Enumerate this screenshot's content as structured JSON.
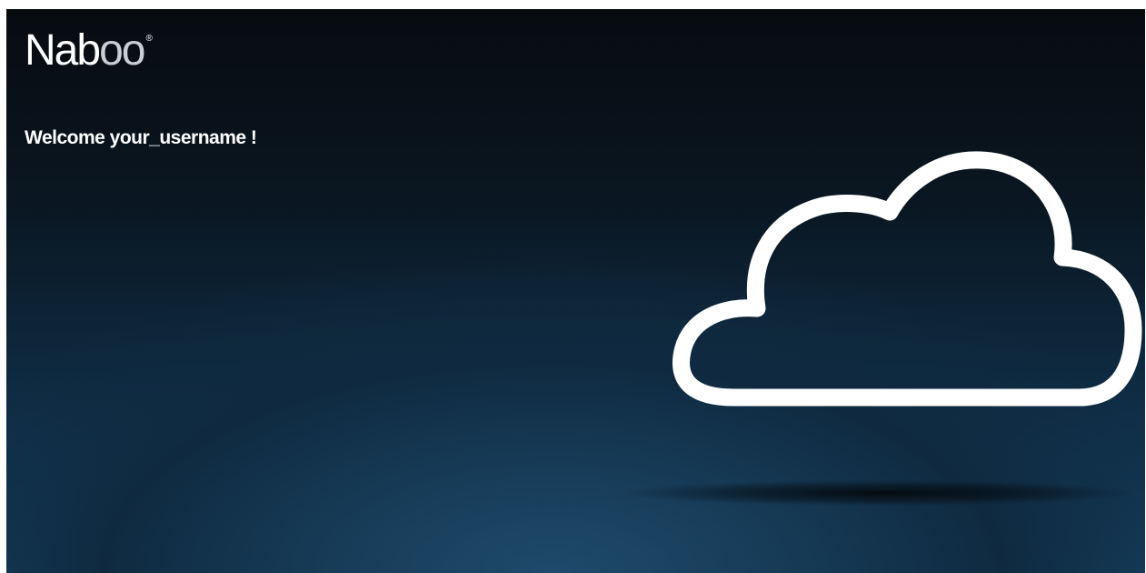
{
  "brand": {
    "name_part1": "Nab",
    "name_part2": "oo",
    "registered": "®"
  },
  "welcome": {
    "text": "Welcome your_username !"
  },
  "hero": {
    "icon": "cloud-icon"
  },
  "colors": {
    "background_top": "#070b10",
    "background_bottom": "#174365",
    "text": "#ffffff",
    "logo_accent": "#c9ced3"
  }
}
